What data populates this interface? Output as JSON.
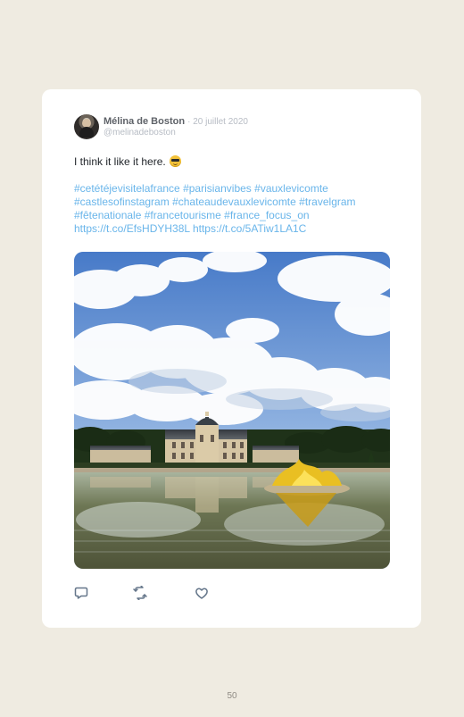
{
  "tweet": {
    "author_name": "Mélina de Boston",
    "date": "· 20 juillet 2020",
    "handle": "@melinadeboston",
    "text": "I think it like it here.",
    "emoji": "smiling-face-with-sunglasses-icon",
    "hashtags": [
      "#cetétéjevisitelafrance",
      "#parisianvibes",
      "#vauxlevicomte",
      "#castlesofinstagram",
      "#chateaudevauxlevicomte",
      "#travelgram",
      "#fêtenationale",
      "#francetourisme",
      "#france_focus_on"
    ],
    "links": [
      "https://t.co/EfsHDYH38L",
      "https://t.co/5ATiw1LA1C"
    ]
  },
  "media": {
    "image_icon": "chateau-vaux-le-vicomte-photo-icon"
  },
  "actions": {
    "reply_icon": "reply-icon",
    "retweet_icon": "retweet-icon",
    "like_icon": "heart-icon"
  },
  "page": {
    "number": "50"
  },
  "colors": {
    "background": "#efebe1",
    "card": "#ffffff",
    "link": "#69b5ea",
    "name": "#5e6268",
    "muted": "#b7bcc4",
    "text": "#1f2328"
  }
}
